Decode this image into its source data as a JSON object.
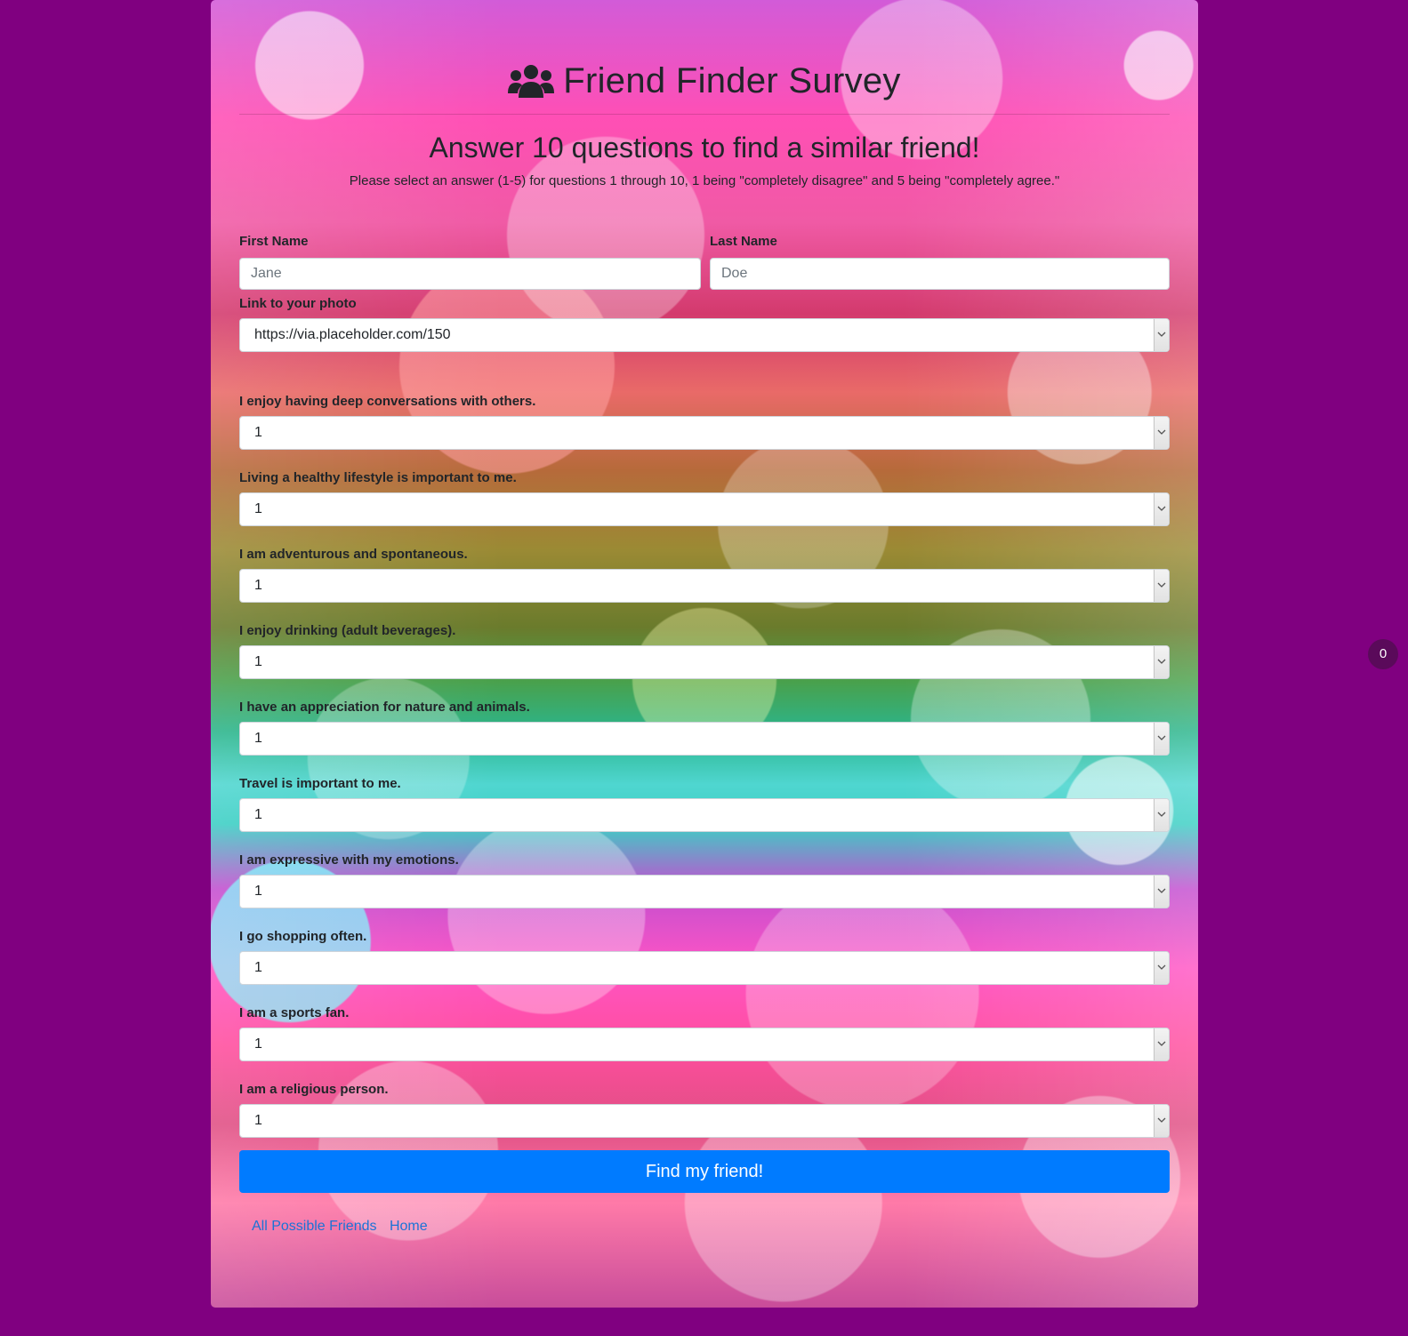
{
  "header": {
    "title": "Friend Finder Survey",
    "icon": "users-icon",
    "subtitle": "Answer 10 questions to find a similar friend!",
    "instructions": "Please select an answer (1-5) for questions 1 through 10, 1 being \"completely disagree\" and 5 being \"completely agree.\""
  },
  "form": {
    "first_name": {
      "label": "First Name",
      "placeholder": "Jane"
    },
    "last_name": {
      "label": "Last Name",
      "placeholder": "Doe"
    },
    "photo": {
      "label": "Link to your photo",
      "value": "https://via.placeholder.com/150"
    },
    "questions": [
      {
        "label": "I enjoy having deep conversations with others.",
        "value": "1"
      },
      {
        "label": "Living a healthy lifestyle is important to me.",
        "value": "1"
      },
      {
        "label": "I am adventurous and spontaneous.",
        "value": "1"
      },
      {
        "label": "I enjoy drinking (adult beverages).",
        "value": "1"
      },
      {
        "label": "I have an appreciation for nature and animals.",
        "value": "1"
      },
      {
        "label": "Travel is important to me.",
        "value": "1"
      },
      {
        "label": "I am expressive with my emotions.",
        "value": "1"
      },
      {
        "label": "I go shopping often.",
        "value": "1"
      },
      {
        "label": "I am a sports fan.",
        "value": "1"
      },
      {
        "label": "I am a religious person.",
        "value": "1"
      }
    ],
    "submit_label": "Find my friend!"
  },
  "footer": {
    "links": [
      "All Possible Friends",
      "Home"
    ]
  },
  "badge": {
    "count": "0"
  },
  "colors": {
    "page_background": "#800080",
    "button_primary": "#007bff",
    "link": "#1b73d6",
    "badge": "#5a0a5a"
  }
}
